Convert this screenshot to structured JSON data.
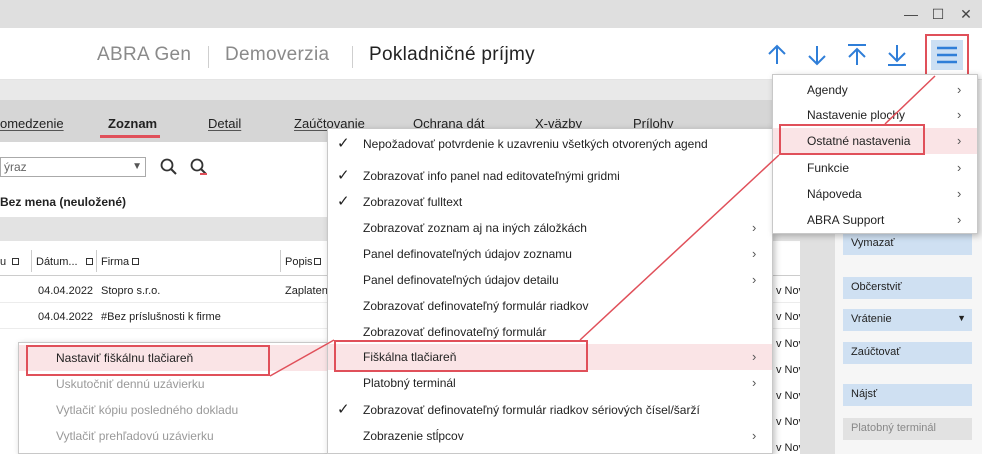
{
  "window": {
    "minimize": "—",
    "maximize": "☐",
    "close": "✕"
  },
  "header": {
    "app": "ABRA Gen",
    "company": "Demoverzia",
    "agenda": "Pokladničné príjmy"
  },
  "tabs": [
    "omedzenie",
    "Zoznam",
    "Detail",
    "Zaúčtovanie",
    "Ochrana dát",
    "X-väzby",
    "Prílohy"
  ],
  "filter": {
    "value": "ýraz"
  },
  "section_title": "Bez mena (neuložené)",
  "grid": {
    "columns": [
      "u",
      "Dátum...",
      "Firma",
      "Popis"
    ],
    "rows": [
      {
        "date": "04.04.2022",
        "firm": "Stopro s.r.o.",
        "desc": "Zaplaten",
        "right": "v Nov"
      },
      {
        "date": "04.04.2022",
        "firm": "#Bez príslušnosti k firme",
        "desc": "",
        "right": "v Nov"
      },
      {
        "date": "",
        "firm": "",
        "desc": "",
        "right": "v Nov"
      },
      {
        "date": "",
        "firm": "",
        "desc": "",
        "right": "v Nov"
      },
      {
        "date": "",
        "firm": "",
        "desc": "",
        "right": "v Nov"
      },
      {
        "date": "",
        "firm": "",
        "desc": "",
        "right": "v Nov"
      },
      {
        "date": "",
        "firm": "",
        "desc": "",
        "right": "v Nov"
      }
    ]
  },
  "right_buttons": [
    "Vymazať",
    "Občerstviť",
    "Vrátenie",
    "Zaúčtovať",
    "Nájsť",
    "Platobný terminál"
  ],
  "main_menu": [
    {
      "label": "Agendy"
    },
    {
      "label": "Nastavenie plochy"
    },
    {
      "label": "Ostatné nastavenia"
    },
    {
      "label": "Funkcie"
    },
    {
      "label": "Nápoveda"
    },
    {
      "label": "ABRA Support"
    }
  ],
  "settings_menu": [
    {
      "label": "Nepožadovať potvrdenie k uzavreniu všetkých otvorených agend",
      "checked": true,
      "arrow": false
    },
    {
      "label": "Zobrazovať info panel nad editovateľnými gridmi",
      "checked": true,
      "arrow": false
    },
    {
      "label": "Zobrazovať fulltext",
      "checked": true,
      "arrow": false
    },
    {
      "label": "Zobrazovať zoznam aj na iných záložkách",
      "checked": false,
      "arrow": true
    },
    {
      "label": "Panel definovateľných údajov zoznamu",
      "checked": false,
      "arrow": true
    },
    {
      "label": "Panel definovateľných údajov detailu",
      "checked": false,
      "arrow": true
    },
    {
      "label": "Zobrazovať definovateľný formulár riadkov",
      "checked": false,
      "arrow": false
    },
    {
      "label": "Zobrazovať definovateľný formulár",
      "checked": false,
      "arrow": false
    },
    {
      "label": "Fiškálna tlačiareň",
      "checked": false,
      "arrow": true
    },
    {
      "label": "Platobný terminál",
      "checked": false,
      "arrow": true
    },
    {
      "label": "Zobrazovať definovateľný formulár riadkov sériových čísel/šarží",
      "checked": true,
      "arrow": false
    },
    {
      "label": "Zobrazenie stĺpcov",
      "checked": false,
      "arrow": true
    }
  ],
  "fiscal_menu": [
    {
      "label": "Nastaviť fiškálnu tlačiareň",
      "disabled": false
    },
    {
      "label": "Uskutočniť dennú uzávierku",
      "disabled": true
    },
    {
      "label": "Vytlačiť kópiu posledného dokladu",
      "disabled": true
    },
    {
      "label": "Vytlačiť prehľadovú uzávierku",
      "disabled": true
    }
  ],
  "colors": {
    "accent": "#e0505a",
    "nav_blue": "#2f7ed8",
    "button_blue": "#cfe0f2",
    "highlight": "#fae4e6"
  }
}
